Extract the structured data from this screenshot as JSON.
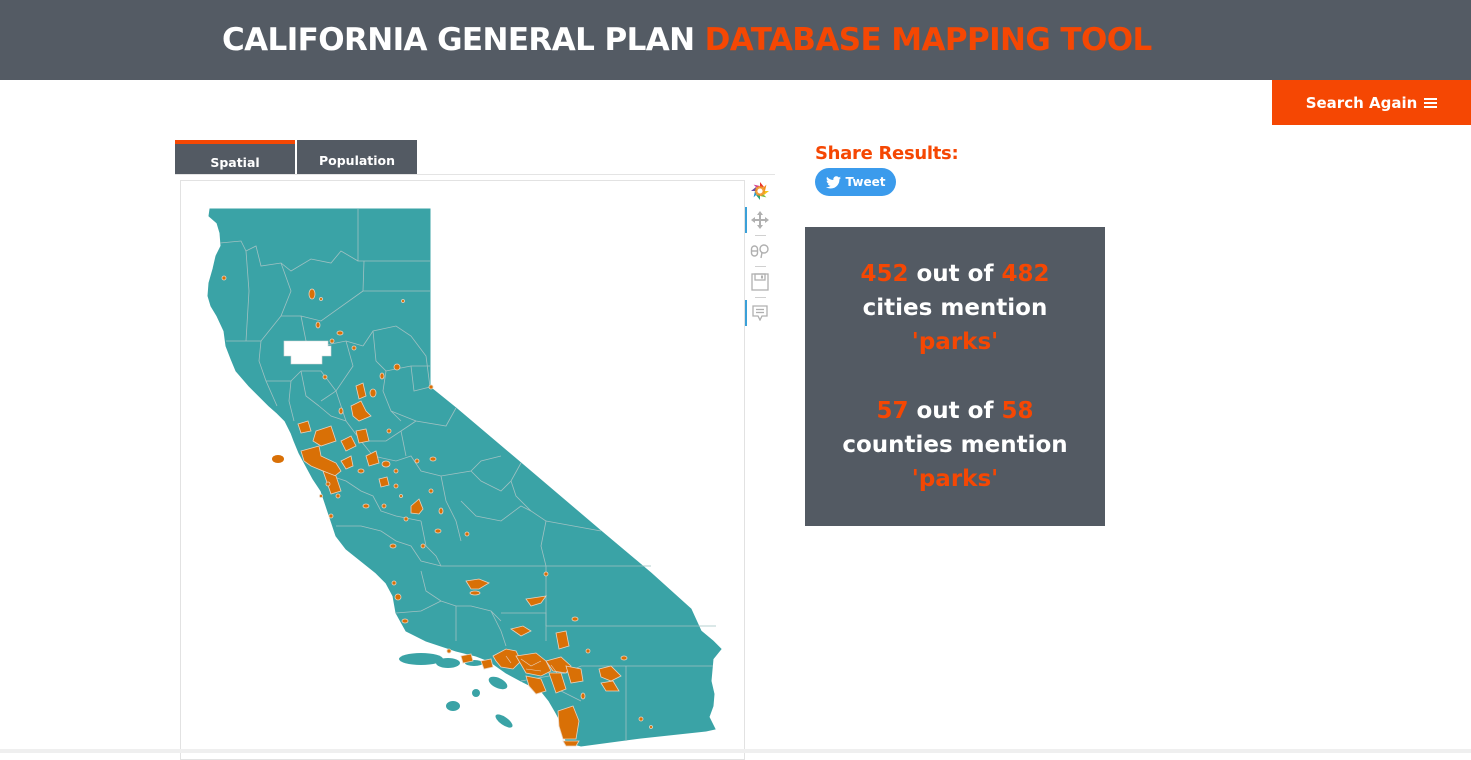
{
  "header": {
    "title_part1": "CALIFORNIA GENERAL PLAN ",
    "title_part2": "DATABASE MAPPING TOOL"
  },
  "actions": {
    "search_again_label": "Search Again",
    "search_again_icon": "hamburger-menu-icon"
  },
  "tabs": [
    {
      "label": "Spatial",
      "active": true
    },
    {
      "label": "Population",
      "active": false
    }
  ],
  "map": {
    "description": "Choropleth map of California counties and cities",
    "colors": {
      "county_fill": "#3aa3a6",
      "county_border": "#9fbcbd",
      "city_mentions": "#d97006",
      "city_outline": "#e8d3c0",
      "no_data": "#ffffff"
    },
    "toolbar": [
      {
        "icon": "plotly-logo-icon",
        "label": "Produced with Plotly"
      },
      {
        "icon": "pan-icon",
        "label": "Pan",
        "active": true
      },
      {
        "icon": "box-select-icon",
        "label": "Box select"
      },
      {
        "icon": "save-icon",
        "label": "Save image"
      },
      {
        "icon": "comment-icon",
        "label": "Hover info",
        "active": true
      }
    ]
  },
  "share": {
    "title": "Share Results:",
    "tweet_label": "Tweet",
    "tweet_icon": "twitter-bird-icon"
  },
  "stats": {
    "cities": {
      "count": "452",
      "out_of_text": "out of",
      "total": "482",
      "label": "cities mention",
      "term": "'parks'"
    },
    "counties": {
      "count": "57",
      "out_of_text": "out of",
      "total": "58",
      "label": "counties mention",
      "term": "'parks'"
    }
  },
  "colors": {
    "header_bg": "#545b64",
    "accent": "#f54703",
    "panel_bg": "#535a63",
    "tweet_blue": "#3b9bec",
    "toolbar_active": "#3aa0d8"
  }
}
